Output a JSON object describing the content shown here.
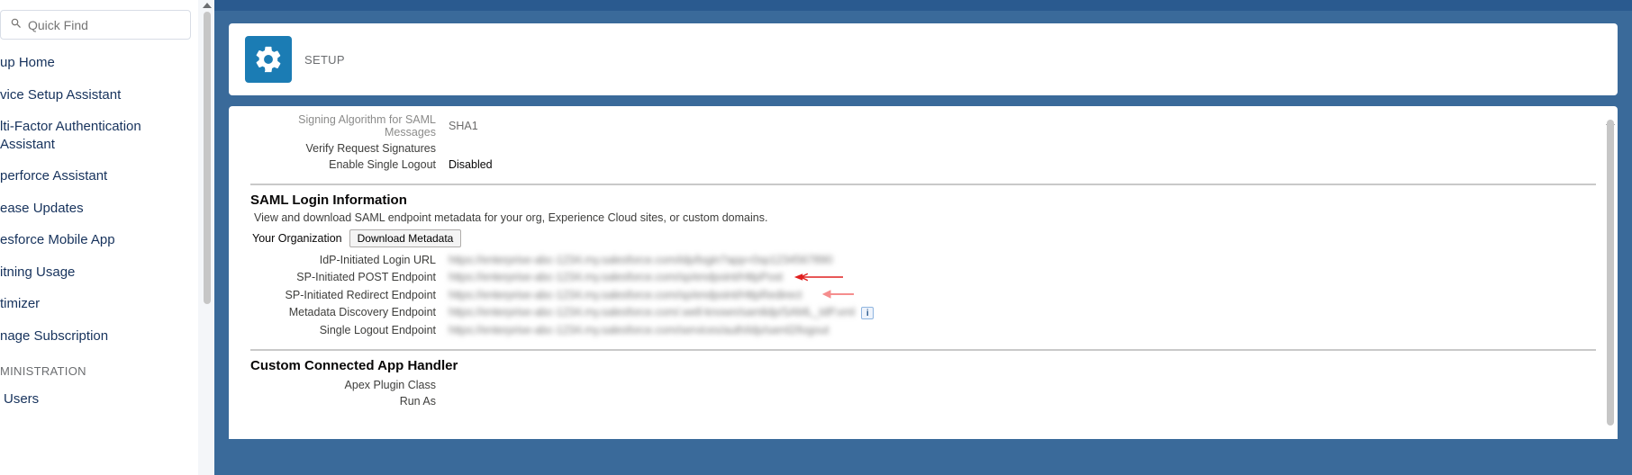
{
  "search": {
    "placeholder": "Quick Find"
  },
  "nav": {
    "items": [
      "up Home",
      "vice Setup Assistant",
      "lti-Factor Authentication Assistant",
      "perforce Assistant",
      "ease Updates",
      "esforce Mobile App",
      "itning Usage",
      "timizer",
      "nage Subscription"
    ],
    "section": "MINISTRATION",
    "subitem": "Users"
  },
  "header": {
    "label": "SETUP"
  },
  "top_fields": {
    "f1_label": "Signing Algorithm for SAML Messages",
    "f1_value": "SHA1",
    "f2_label": "Verify Request Signatures",
    "f3_label": "Enable Single Logout",
    "f3_value": "Disabled"
  },
  "saml": {
    "title": "SAML Login Information",
    "desc": "View and download SAML endpoint metadata for your org, Experience Cloud sites, or custom domains.",
    "org_label": "Your Organization",
    "download_btn": "Download Metadata",
    "r1_label": "IdP-Initiated Login URL",
    "r1_value": "https://enterprise-abc-1234.my.salesforce.com/idp/login?app=0sp1234567890",
    "r2_label": "SP-Initiated POST Endpoint",
    "r2_value": "https://enterprise-abc-1234.my.salesforce.com/sp/endpoint/HttpPost",
    "r3_label": "SP-Initiated Redirect Endpoint",
    "r3_value": "https://enterprise-abc-1234.my.salesforce.com/sp/endpoint/HttpRedirect",
    "r4_label": "Metadata Discovery Endpoint",
    "r4_value": "https://enterprise-abc-1234.my.salesforce.com/.well-known/samlidp/SAML_IdP.xml",
    "r5_label": "Single Logout Endpoint",
    "r5_value": "https://enterprise-abc-1234.my.salesforce.com/services/auth/idp/saml2/logout"
  },
  "handler": {
    "title": "Custom Connected App Handler",
    "f1_label": "Apex Plugin Class",
    "f2_label": "Run As"
  }
}
